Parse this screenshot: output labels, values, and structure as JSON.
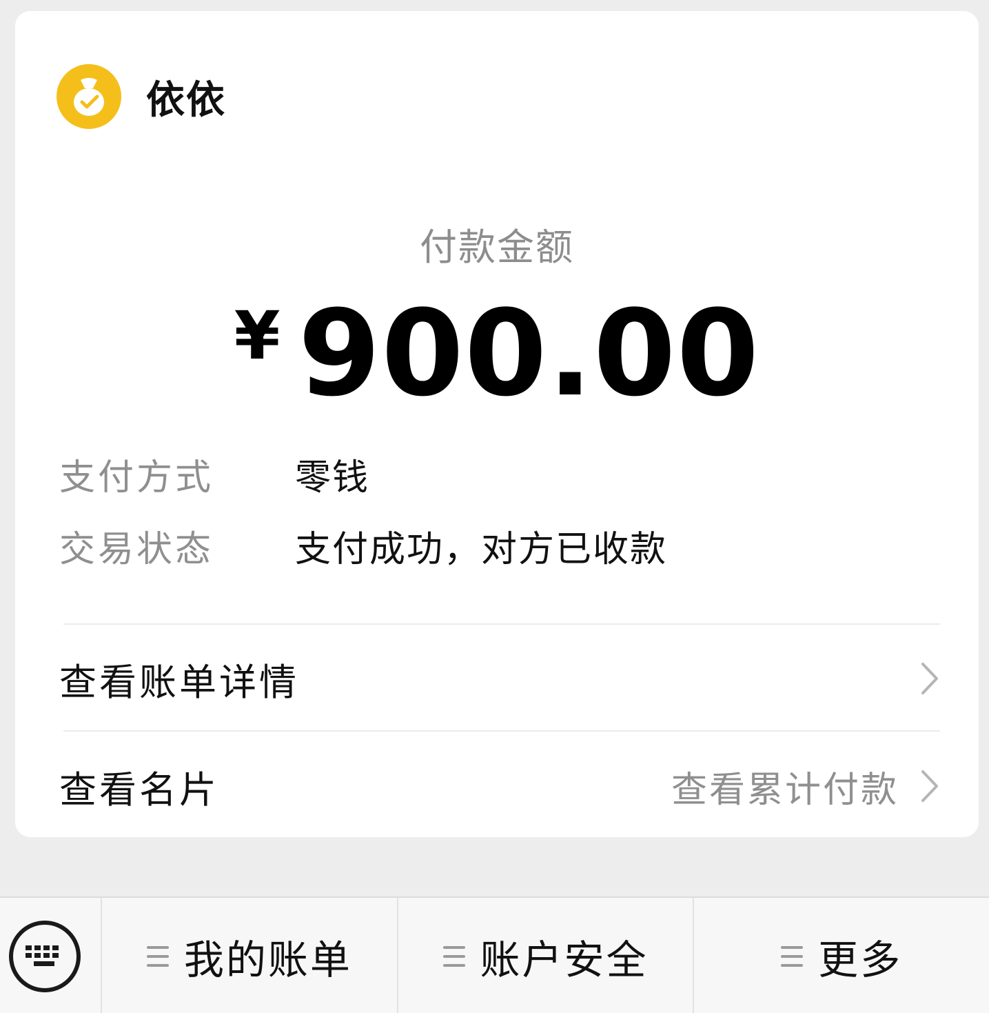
{
  "merchant": {
    "name": "依依",
    "logo_icon": "money-bag-icon",
    "logo_color": "#f4bf1a"
  },
  "payment": {
    "amount_label": "付款金额",
    "currency": "¥",
    "amount": "900.00",
    "details": [
      {
        "key": "支付方式",
        "value": "零钱"
      },
      {
        "key": "交易状态",
        "value": "支付成功，对方已收款"
      }
    ]
  },
  "links": {
    "bill_details": "查看账单详情",
    "business_card": "查看名片",
    "cumulative_payment": "查看累计付款"
  },
  "bottom_menu": {
    "keyboard_icon": "keyboard-icon",
    "items": [
      {
        "label": "我的账单",
        "icon": "menu-list-icon"
      },
      {
        "label": "账户安全",
        "icon": "menu-list-icon"
      },
      {
        "label": "更多",
        "icon": "menu-list-icon"
      }
    ]
  }
}
